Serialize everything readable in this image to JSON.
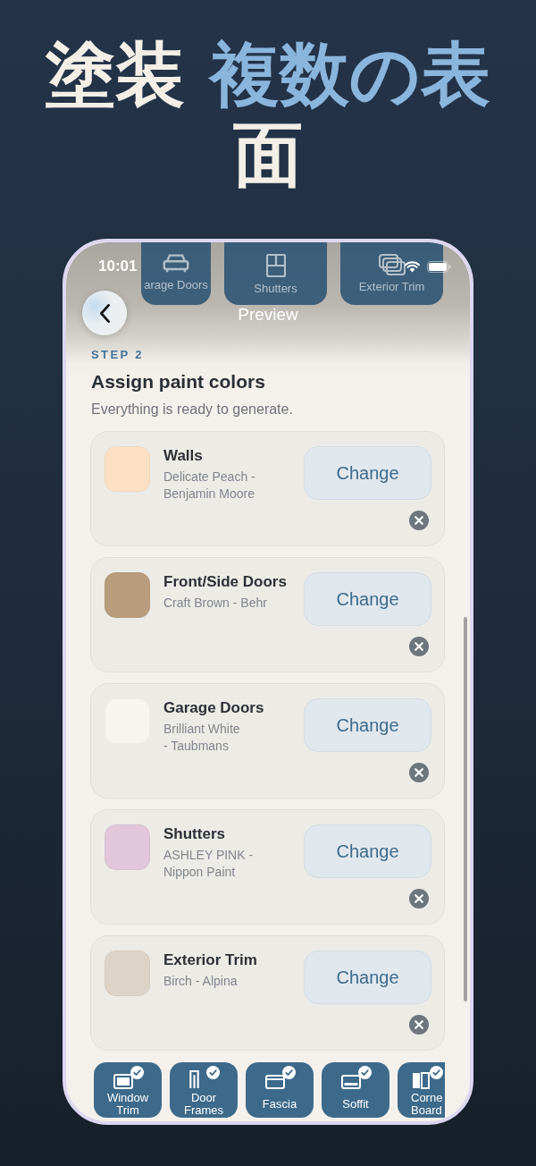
{
  "headline": {
    "text": "塗装 **複数の表**面"
  },
  "status_bar": {
    "time": "10:01"
  },
  "header_tiles": [
    {
      "label": "arage Doors"
    },
    {
      "label": "Shutters"
    },
    {
      "label": "Exterior Trim"
    }
  ],
  "nav": {
    "title": "Preview"
  },
  "step": {
    "label": "STEP 2",
    "title": "Assign paint colors",
    "subtitle": "Everything is ready to generate."
  },
  "assignments": [
    {
      "surface": "Walls",
      "paint": "Delicate Peach -\nBenjamin Moore",
      "color": "#fbe0c4",
      "action": "Change"
    },
    {
      "surface": "Front/Side Doors",
      "paint": "Craft Brown - Behr",
      "color": "#b89c7c",
      "action": "Change"
    },
    {
      "surface": "Garage Doors",
      "paint": "Brilliant White\n- Taubmans",
      "color": "#f6f5ef",
      "action": "Change"
    },
    {
      "surface": "Shutters",
      "paint": "ASHLEY PINK -\nNippon Paint",
      "color": "#e2c6d9",
      "action": "Change"
    },
    {
      "surface": "Exterior Trim",
      "paint": "Birch - Alpina",
      "color": "#ddd3c6",
      "action": "Change"
    }
  ],
  "surface_tiles": [
    {
      "label": "Window\nTrim",
      "checked": true,
      "kind": "full"
    },
    {
      "label": "Door\nFrames",
      "checked": true,
      "kind": "full"
    },
    {
      "label": "Fascia",
      "checked": true,
      "kind": "full"
    },
    {
      "label": "Soffit",
      "checked": true,
      "kind": "full"
    },
    {
      "label": "Corne\nBoard",
      "checked": true,
      "kind": "partial"
    }
  ]
}
